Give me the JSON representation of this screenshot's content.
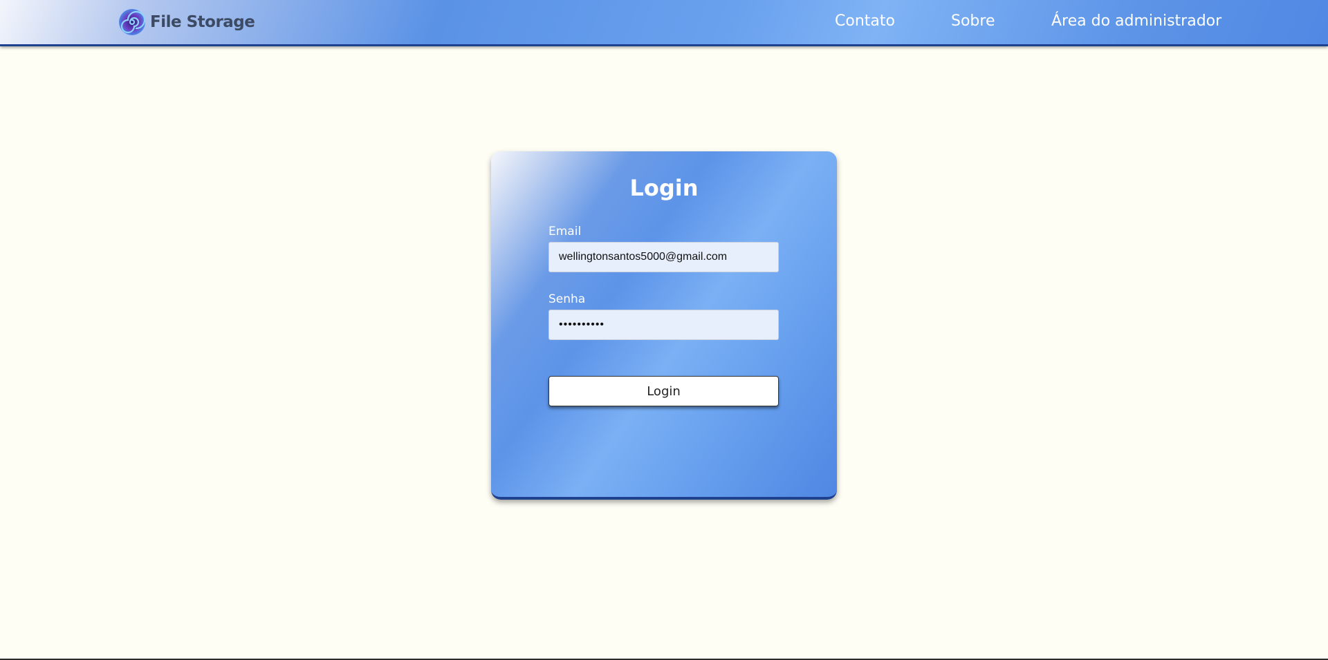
{
  "brand": {
    "name": "File Storage",
    "icon": "spiral-logo-icon"
  },
  "nav": {
    "contato": "Contato",
    "sobre": "Sobre",
    "admin": "Área do administrador"
  },
  "login_form": {
    "title": "Login",
    "email_label": "Email",
    "email_value": "wellingtonsantos5000@gmail.com",
    "password_label": "Senha",
    "password_value": "••••••••••",
    "submit_label": "Login"
  },
  "colors": {
    "background": "#fefef5",
    "primary_blue": "#5a92e6",
    "accent_dark_blue": "#1f3f8f",
    "input_bg": "#e8effc"
  }
}
